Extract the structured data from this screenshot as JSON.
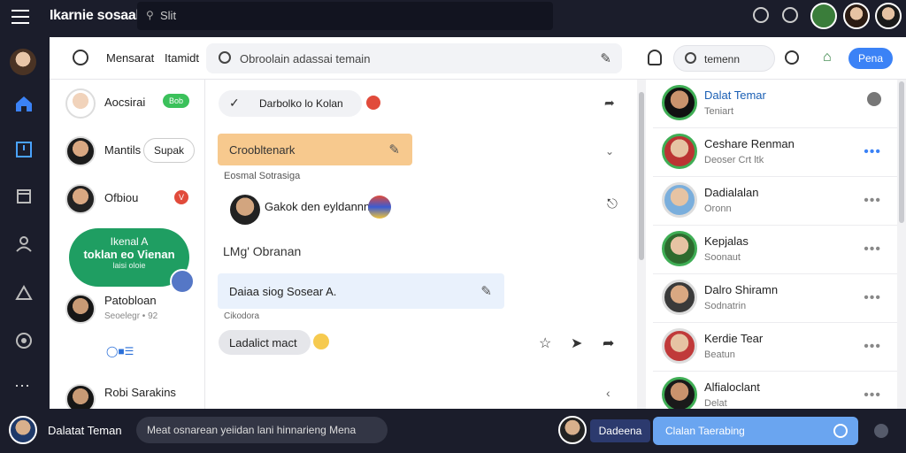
{
  "topbar": {
    "app_title": "Ikarnie sosaall",
    "search_text": "Slit"
  },
  "header": {
    "left_label_1": "Mensarat",
    "left_label_2": "Itamidt",
    "search_text": "Obroolain adassai temain",
    "search2_text": "temenn",
    "button_label": "Pena"
  },
  "contacts": [
    {
      "name": "Aocsirai",
      "badge": "Bob"
    },
    {
      "name": "Mantils",
      "pill": "Supak"
    },
    {
      "name": "Ofbiou",
      "badge": "V"
    },
    {
      "name": "Patobloan",
      "sub": "Seoelegr • 92"
    },
    {
      "name": "Robi Sarakins"
    }
  ],
  "promo": {
    "line1": "Ikenal A",
    "line2": "toklan eo Vienan",
    "line3": "laisi oloie"
  },
  "chat": {
    "title": "Darbolko lo Kolan",
    "bubble_orange": "Croobltenark",
    "meta1": "Eosmal Sotrasiga",
    "row1_text": "Gakok den eyldannn",
    "line_label": "LMg' Obranan",
    "bubble_blue": "Daiaa siog Sosear A.",
    "meta2": "Cikodora",
    "bubble_gray": "Ladalict mact"
  },
  "friends": [
    {
      "name": "Dalat Temar",
      "sub": "Teniart"
    },
    {
      "name": "Ceshare Renman",
      "sub": "Deoser Crt ltk"
    },
    {
      "name": "Dadialalan",
      "sub": "Oronn"
    },
    {
      "name": "Kepjalas",
      "sub": "Soonaut"
    },
    {
      "name": "Dalro Shiramn",
      "sub": "Sodnatrin"
    },
    {
      "name": "Kerdie Tear",
      "sub": "Beatun"
    },
    {
      "name": "Alfialoclant",
      "sub": "Delat"
    }
  ],
  "bottombar": {
    "name": "Dalatat Teman",
    "input_text": "Meat osnarean yeiidan lani hinnarieng Mena",
    "tag": "Dadeena",
    "blue_input": "Clalan Taerabing"
  }
}
